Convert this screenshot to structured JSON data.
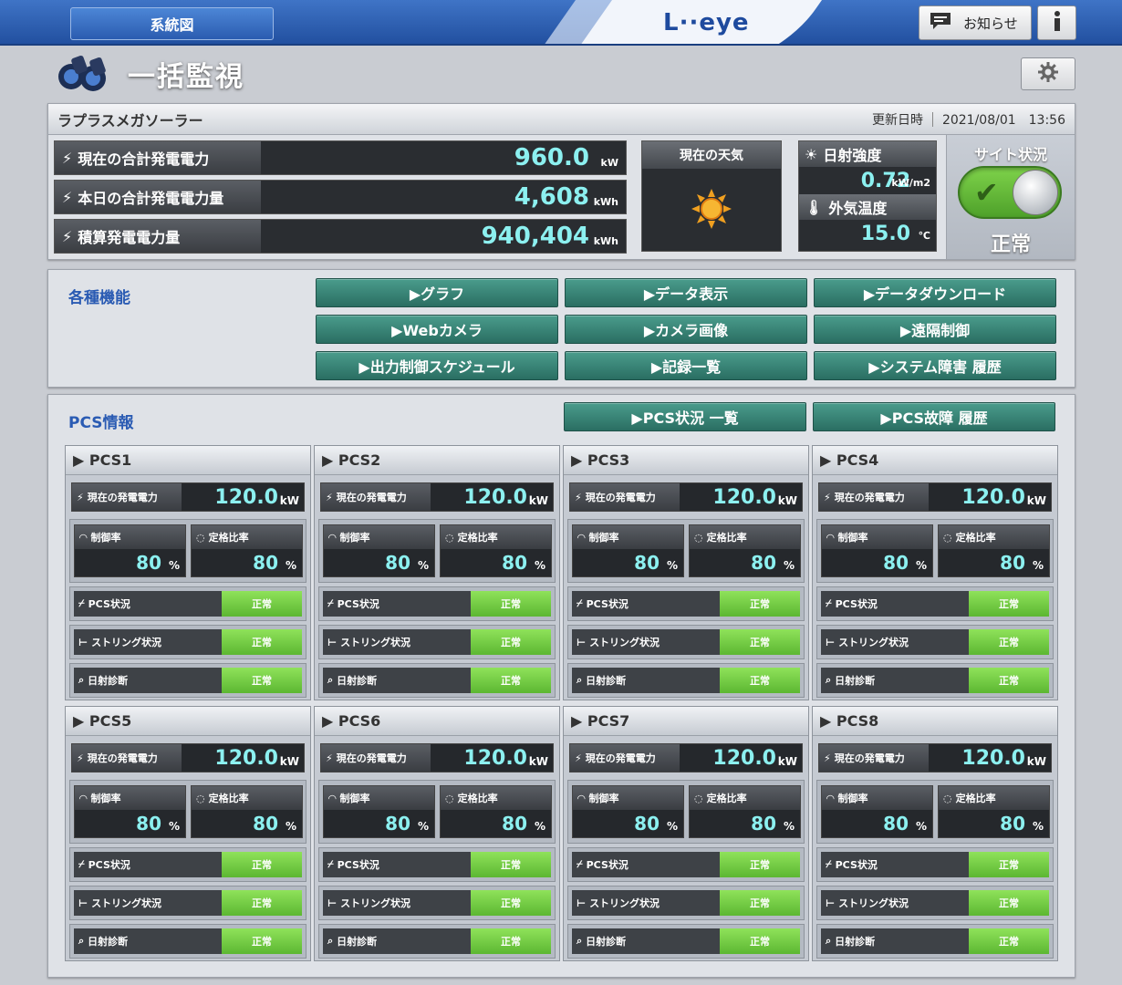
{
  "header": {
    "system_button": "系統図",
    "logo": "L··eye",
    "notice_button": "お知らせ"
  },
  "page": {
    "title": "一括監視"
  },
  "site": {
    "name": "ラプラスメガソーラー",
    "updated_label": "更新日時",
    "updated_value": "2021/08/01　13:56",
    "metrics": [
      {
        "label": "現在の合計発電電力",
        "value": "960.0",
        "unit": "kW"
      },
      {
        "label": "本日の合計発電電力量",
        "value": "4,608",
        "unit": "kWh"
      },
      {
        "label": "積算発電電力量",
        "value": "940,404",
        "unit": "kWh"
      }
    ],
    "weather": {
      "label": "現在の天気",
      "icon": "sun-icon"
    },
    "irradiance": {
      "label": "日射強度",
      "value": "0.72",
      "unit": "kW/m2"
    },
    "temperature": {
      "label": "外気温度",
      "value": "15.0",
      "unit": "℃"
    },
    "status": {
      "label": "サイト状況",
      "value": "正常",
      "on": true
    }
  },
  "functions": {
    "title": "各種機能",
    "buttons": [
      "▶グラフ",
      "▶データ表示",
      "▶データダウンロード",
      "▶Webカメラ",
      "▶カメラ画像",
      "▶遠隔制御",
      "▶出力制御スケジュール",
      "▶記録一覧",
      "▶システム障害 履歴"
    ]
  },
  "pcs_info": {
    "title": "PCS情報",
    "buttons": [
      "▶PCS状況 一覧",
      "▶PCS故障 履歴"
    ],
    "labels": {
      "power": "現在の発電電力",
      "power_unit": "kW",
      "control_rate": "制御率",
      "rated_ratio": "定格比率",
      "rate_unit": "%",
      "pcs_status": "PCS状況",
      "string_status": "ストリング状況",
      "irradiance_diag": "日射診断"
    },
    "units": [
      {
        "name": "▶ PCS1",
        "power": "120.0",
        "control_rate": "80",
        "rated_ratio": "80",
        "pcs_status": "正常",
        "string_status": "正常",
        "irradiance_diag": "正常"
      },
      {
        "name": "▶ PCS2",
        "power": "120.0",
        "control_rate": "80",
        "rated_ratio": "80",
        "pcs_status": "正常",
        "string_status": "正常",
        "irradiance_diag": "正常"
      },
      {
        "name": "▶ PCS3",
        "power": "120.0",
        "control_rate": "80",
        "rated_ratio": "80",
        "pcs_status": "正常",
        "string_status": "正常",
        "irradiance_diag": "正常"
      },
      {
        "name": "▶ PCS4",
        "power": "120.0",
        "control_rate": "80",
        "rated_ratio": "80",
        "pcs_status": "正常",
        "string_status": "正常",
        "irradiance_diag": "正常"
      },
      {
        "name": "▶ PCS5",
        "power": "120.0",
        "control_rate": "80",
        "rated_ratio": "80",
        "pcs_status": "正常",
        "string_status": "正常",
        "irradiance_diag": "正常"
      },
      {
        "name": "▶ PCS6",
        "power": "120.0",
        "control_rate": "80",
        "rated_ratio": "80",
        "pcs_status": "正常",
        "string_status": "正常",
        "irradiance_diag": "正常"
      },
      {
        "name": "▶ PCS7",
        "power": "120.0",
        "control_rate": "80",
        "rated_ratio": "80",
        "pcs_status": "正常",
        "string_status": "正常",
        "irradiance_diag": "正常"
      },
      {
        "name": "▶ PCS8",
        "power": "120.0",
        "control_rate": "80",
        "rated_ratio": "80",
        "pcs_status": "正常",
        "string_status": "正常",
        "irradiance_diag": "正常"
      }
    ]
  },
  "colors": {
    "accent_blue": "#2a5bb3",
    "button_teal": "#2a6e62",
    "value_cyan": "#8cf0f0",
    "ok_green": "#5cb732"
  }
}
